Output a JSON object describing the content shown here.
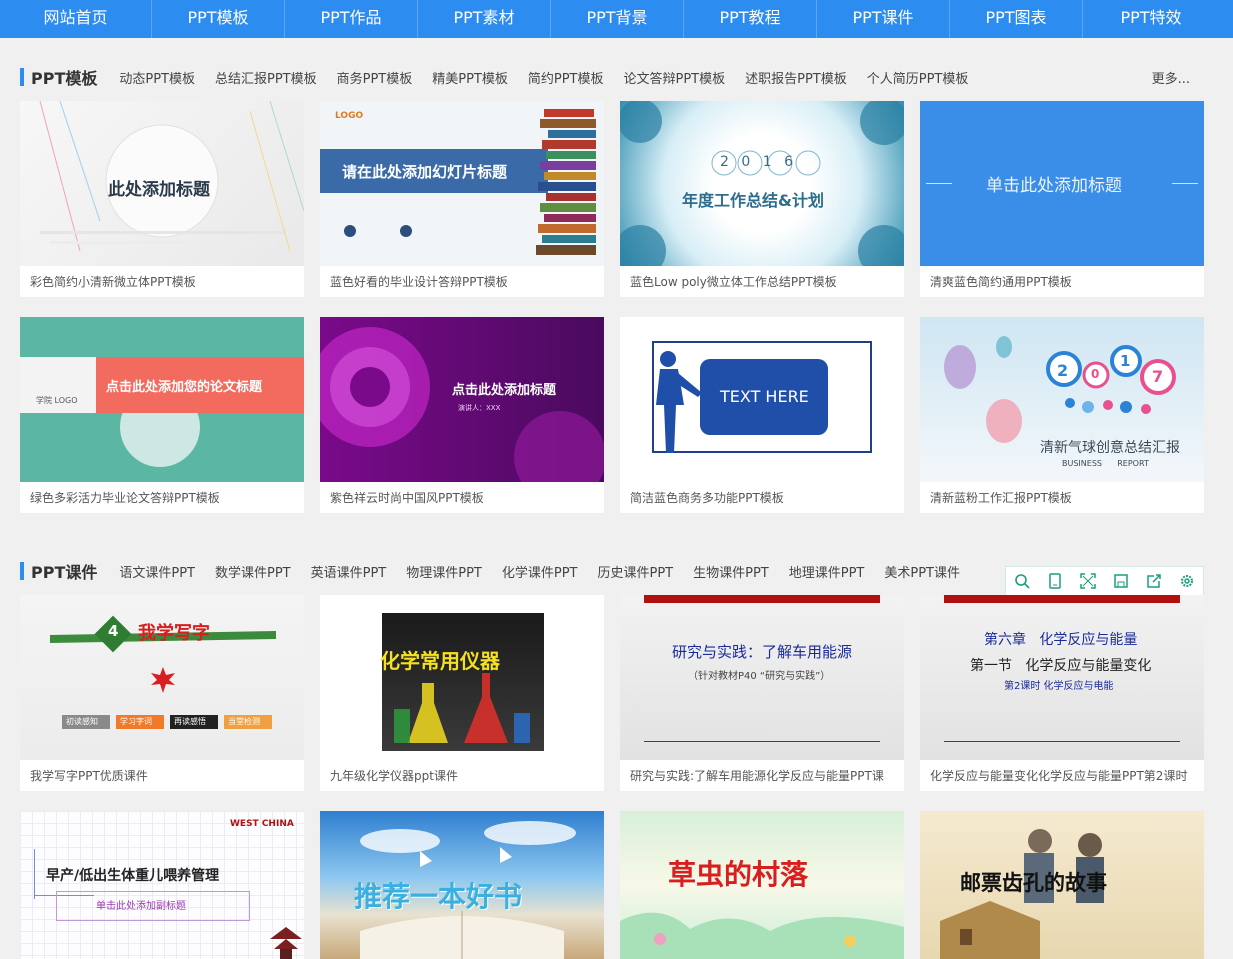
{
  "nav": [
    "网站首页",
    "PPT模板",
    "PPT作品",
    "PPT素材",
    "PPT背景",
    "PPT教程",
    "PPT课件",
    "PPT图表",
    "PPT特效"
  ],
  "section1": {
    "title": "PPT模板",
    "links": [
      "动态PPT模板",
      "总结汇报PPT模板",
      "商务PPT模板",
      "精美PPT模板",
      "简约PPT模板",
      "论文答辩PPT模板",
      "述职报告PPT模板",
      "个人简历PPT模板"
    ],
    "more": "更多..."
  },
  "section2": {
    "title": "PPT课件",
    "links": [
      "语文课件PPT",
      "数学课件PPT",
      "英语课件PPT",
      "物理课件PPT",
      "化学课件PPT",
      "历史课件PPT",
      "生物课件PPT",
      "地理课件PPT",
      "美术PPT课件"
    ]
  },
  "cards": [
    {
      "caption": "彩色简约小清新微立体PPT模板",
      "thumb_text": "此处添加标题"
    },
    {
      "caption": "蓝色好看的毕业设计答辩PPT模板",
      "thumb_text": "请在此处添加幻灯片标题",
      "logo": "LOGO"
    },
    {
      "caption": "蓝色Low poly微立体工作总结PPT模板",
      "thumb_text": "年度工作总结&计划",
      "year": "2 0 1 6"
    },
    {
      "caption": "清爽蓝色简约通用PPT模板",
      "thumb_text": "单击此处添加标题"
    },
    {
      "caption": "绿色多彩活力毕业论文答辩PPT模板",
      "thumb_text": "点击此处添加您的论文标题",
      "logo": "学院 LOGO"
    },
    {
      "caption": "紫色祥云时尚中国风PPT模板",
      "thumb_text": "点击此处添加标题",
      "sub": "演讲人：XXX"
    },
    {
      "caption": "简洁蓝色商务多功能PPT模板",
      "thumb_text": "TEXT HERE"
    },
    {
      "caption": "清新蓝粉工作汇报PPT模板",
      "thumb_text": "清新气球创意总结汇报",
      "sub": "BUSINESS      REPORT"
    },
    {
      "caption": "我学写字PPT优质课件",
      "thumb_text": "我学写字",
      "badge": "4",
      "chips": [
        "初读感知",
        "学习字词",
        "再读感悟",
        "当堂检测"
      ]
    },
    {
      "caption": "九年级化学仪器ppt课件",
      "thumb_text": "化学常用仪器"
    },
    {
      "caption": "研究与实践:了解车用能源化学反应与能量PPT课",
      "thumb_text": "研究与实践：了解车用能源",
      "sub": "（针对教材P40 “研究与实践”）"
    },
    {
      "caption": "化学反应与能量变化化学反应与能量PPT第2课时",
      "thumb_text": "第六章   化学反应与能量",
      "line2": "第一节   化学反应与能量变化",
      "line3": "第2课时 化学反应与电能"
    },
    {
      "caption": "",
      "thumb_text": "早产/低出生体重儿喂养管理",
      "sub": "单击此处添加副标题",
      "logo": "WEST CHINA"
    },
    {
      "caption": "",
      "thumb_text": "推荐一本好书"
    },
    {
      "caption": "",
      "thumb_text": "草虫的村落"
    },
    {
      "caption": "",
      "thumb_text": "邮票齿孔的故事"
    }
  ],
  "colors": {
    "nav": "#2d8cf0",
    "accent": "#2d8cf0"
  },
  "toolbar": [
    "search-icon",
    "tablet-icon",
    "expand-icon",
    "save-icon",
    "share-icon",
    "gear-icon"
  ]
}
